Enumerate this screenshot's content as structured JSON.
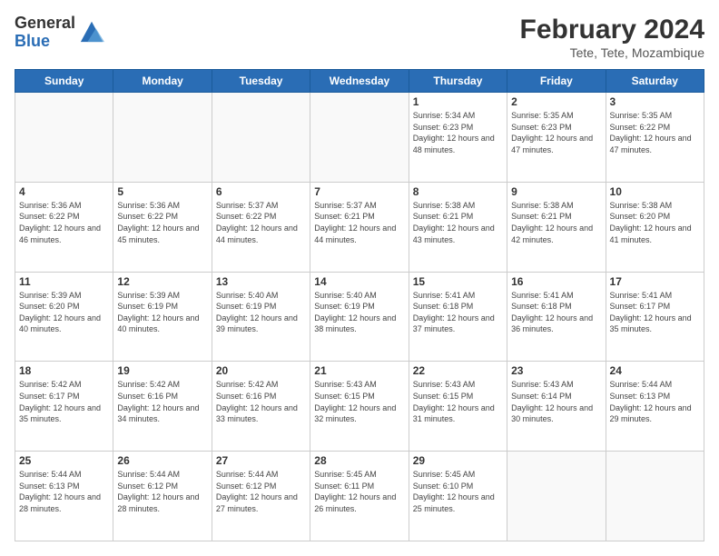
{
  "logo": {
    "general": "General",
    "blue": "Blue"
  },
  "header": {
    "month": "February 2024",
    "location": "Tete, Tete, Mozambique"
  },
  "days_of_week": [
    "Sunday",
    "Monday",
    "Tuesday",
    "Wednesday",
    "Thursday",
    "Friday",
    "Saturday"
  ],
  "weeks": [
    [
      {
        "day": "",
        "info": ""
      },
      {
        "day": "",
        "info": ""
      },
      {
        "day": "",
        "info": ""
      },
      {
        "day": "",
        "info": ""
      },
      {
        "day": "1",
        "info": "Sunrise: 5:34 AM\nSunset: 6:23 PM\nDaylight: 12 hours and 48 minutes."
      },
      {
        "day": "2",
        "info": "Sunrise: 5:35 AM\nSunset: 6:23 PM\nDaylight: 12 hours and 47 minutes."
      },
      {
        "day": "3",
        "info": "Sunrise: 5:35 AM\nSunset: 6:22 PM\nDaylight: 12 hours and 47 minutes."
      }
    ],
    [
      {
        "day": "4",
        "info": "Sunrise: 5:36 AM\nSunset: 6:22 PM\nDaylight: 12 hours and 46 minutes."
      },
      {
        "day": "5",
        "info": "Sunrise: 5:36 AM\nSunset: 6:22 PM\nDaylight: 12 hours and 45 minutes."
      },
      {
        "day": "6",
        "info": "Sunrise: 5:37 AM\nSunset: 6:22 PM\nDaylight: 12 hours and 44 minutes."
      },
      {
        "day": "7",
        "info": "Sunrise: 5:37 AM\nSunset: 6:21 PM\nDaylight: 12 hours and 44 minutes."
      },
      {
        "day": "8",
        "info": "Sunrise: 5:38 AM\nSunset: 6:21 PM\nDaylight: 12 hours and 43 minutes."
      },
      {
        "day": "9",
        "info": "Sunrise: 5:38 AM\nSunset: 6:21 PM\nDaylight: 12 hours and 42 minutes."
      },
      {
        "day": "10",
        "info": "Sunrise: 5:38 AM\nSunset: 6:20 PM\nDaylight: 12 hours and 41 minutes."
      }
    ],
    [
      {
        "day": "11",
        "info": "Sunrise: 5:39 AM\nSunset: 6:20 PM\nDaylight: 12 hours and 40 minutes."
      },
      {
        "day": "12",
        "info": "Sunrise: 5:39 AM\nSunset: 6:19 PM\nDaylight: 12 hours and 40 minutes."
      },
      {
        "day": "13",
        "info": "Sunrise: 5:40 AM\nSunset: 6:19 PM\nDaylight: 12 hours and 39 minutes."
      },
      {
        "day": "14",
        "info": "Sunrise: 5:40 AM\nSunset: 6:19 PM\nDaylight: 12 hours and 38 minutes."
      },
      {
        "day": "15",
        "info": "Sunrise: 5:41 AM\nSunset: 6:18 PM\nDaylight: 12 hours and 37 minutes."
      },
      {
        "day": "16",
        "info": "Sunrise: 5:41 AM\nSunset: 6:18 PM\nDaylight: 12 hours and 36 minutes."
      },
      {
        "day": "17",
        "info": "Sunrise: 5:41 AM\nSunset: 6:17 PM\nDaylight: 12 hours and 35 minutes."
      }
    ],
    [
      {
        "day": "18",
        "info": "Sunrise: 5:42 AM\nSunset: 6:17 PM\nDaylight: 12 hours and 35 minutes."
      },
      {
        "day": "19",
        "info": "Sunrise: 5:42 AM\nSunset: 6:16 PM\nDaylight: 12 hours and 34 minutes."
      },
      {
        "day": "20",
        "info": "Sunrise: 5:42 AM\nSunset: 6:16 PM\nDaylight: 12 hours and 33 minutes."
      },
      {
        "day": "21",
        "info": "Sunrise: 5:43 AM\nSunset: 6:15 PM\nDaylight: 12 hours and 32 minutes."
      },
      {
        "day": "22",
        "info": "Sunrise: 5:43 AM\nSunset: 6:15 PM\nDaylight: 12 hours and 31 minutes."
      },
      {
        "day": "23",
        "info": "Sunrise: 5:43 AM\nSunset: 6:14 PM\nDaylight: 12 hours and 30 minutes."
      },
      {
        "day": "24",
        "info": "Sunrise: 5:44 AM\nSunset: 6:13 PM\nDaylight: 12 hours and 29 minutes."
      }
    ],
    [
      {
        "day": "25",
        "info": "Sunrise: 5:44 AM\nSunset: 6:13 PM\nDaylight: 12 hours and 28 minutes."
      },
      {
        "day": "26",
        "info": "Sunrise: 5:44 AM\nSunset: 6:12 PM\nDaylight: 12 hours and 28 minutes."
      },
      {
        "day": "27",
        "info": "Sunrise: 5:44 AM\nSunset: 6:12 PM\nDaylight: 12 hours and 27 minutes."
      },
      {
        "day": "28",
        "info": "Sunrise: 5:45 AM\nSunset: 6:11 PM\nDaylight: 12 hours and 26 minutes."
      },
      {
        "day": "29",
        "info": "Sunrise: 5:45 AM\nSunset: 6:10 PM\nDaylight: 12 hours and 25 minutes."
      },
      {
        "day": "",
        "info": ""
      },
      {
        "day": "",
        "info": ""
      }
    ]
  ]
}
